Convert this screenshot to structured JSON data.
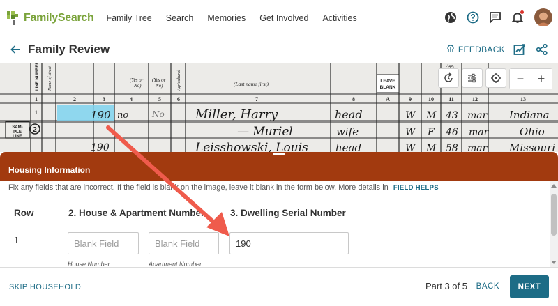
{
  "nav": {
    "logo_text": "FamilySearch",
    "links": [
      "Family Tree",
      "Search",
      "Memories",
      "Get Involved",
      "Activities"
    ],
    "icons": [
      "globe-icon",
      "help-icon",
      "messages-icon",
      "notifications-icon"
    ]
  },
  "header": {
    "title": "Family Review",
    "feedback_label": "FEEDBACK"
  },
  "census": {
    "col_numbers": [
      "1",
      "2",
      "3",
      "4",
      "5",
      "6",
      "7",
      "8",
      "A",
      "9",
      "10",
      "11",
      "12",
      "13"
    ],
    "yes_no_label": "(Yes or No)",
    "name_header": "(Last name first)",
    "leave_blank": "LEAVE BLANK",
    "line_label": "LINE NUMBER",
    "sample_line": "SAM-PLE LINE",
    "row_values": {
      "dwelling": "190",
      "name1": "Miller, Harry",
      "name2": "— Muriel",
      "name3": "Leisshowski, Louis",
      "rel1": "head",
      "rel2": "wife",
      "rel3": "head",
      "race1": "W",
      "race2": "W",
      "race3": "W",
      "sex1": "M",
      "sex2": "F",
      "sex3": "M",
      "age1": "43",
      "age2": "46",
      "age3": "58",
      "mar1": "mar",
      "mar2": "mar",
      "mar3": "mar",
      "bp1": "Indiana",
      "bp2": "Ohio",
      "bp3": "Missouri"
    }
  },
  "panel": {
    "title": "Housing Information",
    "instructions": "Fix any fields that are incorrect. If the field is blank on the image, leave it blank in the form below. More details in",
    "field_helps": "FIELD HELPS",
    "headers": {
      "row": "Row",
      "house": "2. House & Apartment Number",
      "dwelling": "3. Dwelling Serial Number"
    },
    "row_number": "1",
    "house_placeholder": "Blank Field",
    "apartment_placeholder": "Blank Field",
    "dwelling_value": "190",
    "house_sublabel": "House Number",
    "apartment_sublabel": "Apartment Number"
  },
  "footer": {
    "skip_label": "SKIP HOUSEHOLD",
    "part_text": "Part 3 of 5",
    "back_label": "BACK",
    "next_label": "NEXT"
  },
  "colors": {
    "brand_green": "#7aa33a",
    "panel_header": "#a23a0f",
    "link_teal": "#1d6c86",
    "annotation_arrow": "#ef5b4c",
    "highlight_cell": "#7fd3ef"
  }
}
